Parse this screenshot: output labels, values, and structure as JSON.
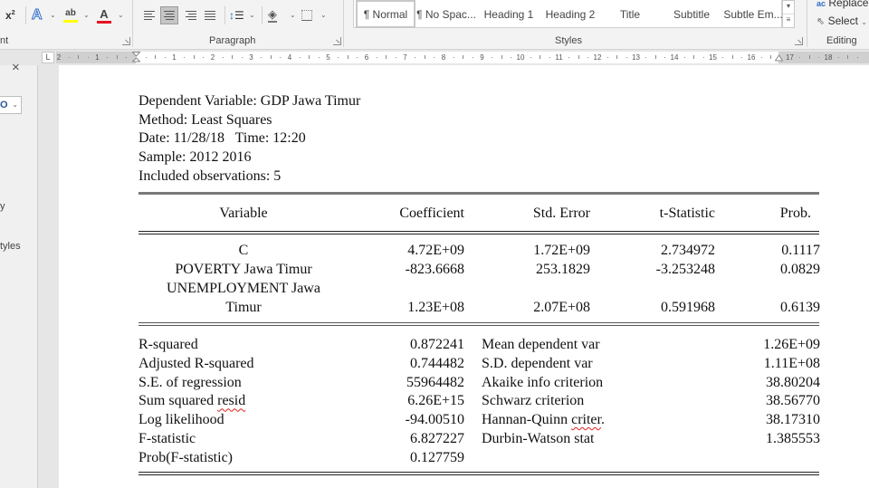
{
  "ribbon": {
    "font_group": {
      "label_fragment": "nt",
      "superscript_icon": "x²",
      "text_effects_icon": "A",
      "highlight_icon": "ab",
      "font_color_icon": "A",
      "highlight_color": "#ffff00",
      "font_color": "#e81123"
    },
    "paragraph_group": {
      "label": "Paragraph",
      "active_alignment": "center"
    },
    "styles_group": {
      "label": "Styles",
      "items": [
        {
          "label": "¶ Normal",
          "selected": true
        },
        {
          "label": "¶ No Spac...",
          "selected": false
        },
        {
          "label": "Heading 1",
          "selected": false
        },
        {
          "label": "Heading 2",
          "selected": false
        },
        {
          "label": "Title",
          "selected": false
        },
        {
          "label": "Subtitle",
          "selected": false
        },
        {
          "label": "Subtle Em...",
          "selected": false
        }
      ]
    },
    "editing_group": {
      "label": "Editing",
      "replace_label": "Replace",
      "select_label": "Select",
      "replace_icon": "ab→ac",
      "select_icon": "cursor-arrow"
    }
  },
  "ruler": {
    "tab_selector": "L",
    "left_numbers": [
      "2",
      "1"
    ],
    "numbers": [
      "1",
      "2",
      "3",
      "4",
      "5",
      "6",
      "7",
      "8",
      "9",
      "10",
      "11",
      "12",
      "13",
      "14",
      "15",
      "16",
      "17",
      "18"
    ]
  },
  "nav_pane": {
    "close_icon": "×",
    "search_glyph": "O",
    "fragment_1": "y",
    "fragment_2": "tyles"
  },
  "document": {
    "header_lines": [
      "Dependent Variable: GDP Jawa Timur",
      "Method: Least Squares",
      "Date: 11/28/18   Time: 12:20",
      "Sample: 2012 2016",
      "Included observations: 5"
    ],
    "table": {
      "columns": [
        "Variable",
        "Coefficient",
        "Std. Error",
        "t-Statistic",
        "Prob."
      ],
      "rows": [
        {
          "variable": [
            "C"
          ],
          "coefficient": "4.72E+09",
          "std_error": "1.72E+09",
          "t_statistic": "2.734972",
          "prob": "0.1117"
        },
        {
          "variable": [
            "POVERTY Jawa Timur"
          ],
          "coefficient": "-823.6668",
          "std_error": "253.1829",
          "t_statistic": "-3.253248",
          "prob": "0.0829"
        },
        {
          "variable": [
            "UNEMPLOYMENT Jawa",
            "Timur"
          ],
          "coefficient": "1.23E+08",
          "std_error": "2.07E+08",
          "t_statistic": "0.591968",
          "prob": "0.6139"
        }
      ]
    },
    "stats_left": [
      {
        "label": "R-squared",
        "value": "0.872241"
      },
      {
        "label": "Adjusted R-squared",
        "value": "0.744482"
      },
      {
        "label": "S.E. of regression",
        "value": "55964482"
      },
      {
        "label": "Sum squared resid",
        "value": "6.26E+15",
        "spell_flag_word": "resid"
      },
      {
        "label": "Log likelihood",
        "value": "-94.00510"
      },
      {
        "label": "F-statistic",
        "value": "6.827227"
      },
      {
        "label": "Prob(F-statistic)",
        "value": "0.127759"
      }
    ],
    "stats_right": [
      {
        "label": "Mean dependent var",
        "value": "1.26E+09"
      },
      {
        "label": "S.D. dependent var",
        "value": "1.11E+08"
      },
      {
        "label": "Akaike info criterion",
        "value": "38.80204"
      },
      {
        "label": "Schwarz criterion",
        "value": "38.56770"
      },
      {
        "label": "Hannan-Quinn criter.",
        "value": "38.17310",
        "spell_flag_word": "criter"
      },
      {
        "label": "Durbin-Watson stat",
        "value": "1.385553"
      }
    ]
  }
}
